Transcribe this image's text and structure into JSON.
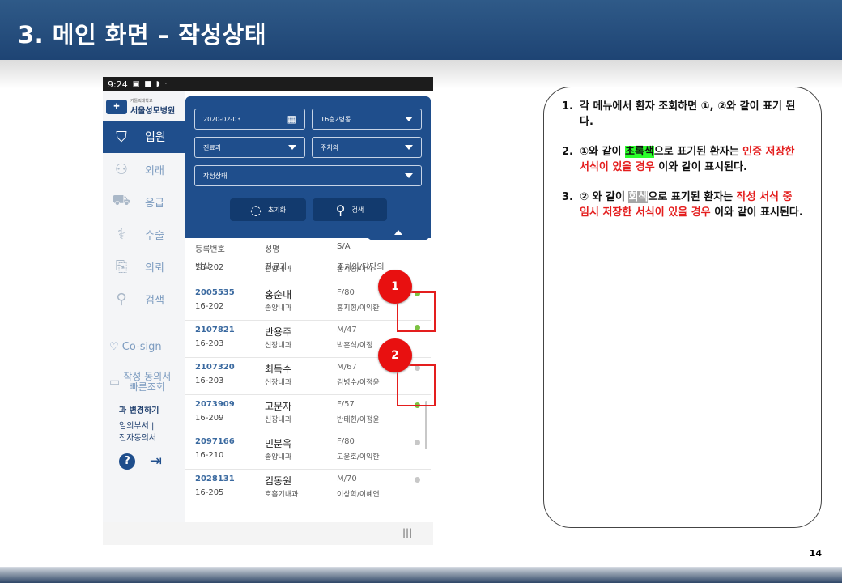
{
  "slide": {
    "title": "3. 메인 화면 – 작성상태",
    "page_number": "14"
  },
  "phone": {
    "status_time": "9:24",
    "hospital_sub": "가톨릭대학교",
    "hospital_name": "서울성모병원",
    "nav": [
      {
        "label": "입원",
        "icon": "inpatient-icon",
        "active": true
      },
      {
        "label": "외래",
        "icon": "outpatient-icon",
        "active": false
      },
      {
        "label": "응급",
        "icon": "ambulance-icon",
        "active": false
      },
      {
        "label": "수술",
        "icon": "surgery-icon",
        "active": false
      },
      {
        "label": "의뢰",
        "icon": "referral-icon",
        "active": false
      },
      {
        "label": "검색",
        "icon": "search-icon",
        "active": false
      }
    ],
    "cosign_label": "Co-sign",
    "consent_label_1": "작성 동의서",
    "consent_label_2": "빠른조회",
    "dept_change": "과 변경하기",
    "temp_link_1": "임의부서 |",
    "temp_link_2": "전자동의서",
    "help_label": "?",
    "filters": {
      "date": "2020-02-03",
      "ward": "16층2병동",
      "dept": "진료과",
      "doctor": "주치의",
      "status": "작성상태",
      "reset_label": "초기화",
      "search_label": "검색"
    },
    "columns": {
      "id": "등록번호",
      "name": "성명",
      "sa": "S/A",
      "room": "병실",
      "dept": "진료과",
      "doctor": "주치의/담당의"
    },
    "rows": [
      {
        "id": "",
        "room": "16-202",
        "name": "",
        "dept": "종양내과",
        "sa": "",
        "doctor": "홍지형/이익",
        "status": "none"
      },
      {
        "id": "2005535",
        "room": "16-202",
        "name": "홍순내",
        "dept": "종양내과",
        "sa": "F/80",
        "doctor": "홍지형/이익환",
        "status": "green"
      },
      {
        "id": "2107821",
        "room": "16-203",
        "name": "반용주",
        "dept": "신장내과",
        "sa": "M/47",
        "doctor": "박훈석/이정",
        "status": "green"
      },
      {
        "id": "2107320",
        "room": "16-203",
        "name": "최득수",
        "dept": "신장내과",
        "sa": "M/67",
        "doctor": "김병수/이정윤",
        "status": "gray"
      },
      {
        "id": "2073909",
        "room": "16-209",
        "name": "고문자",
        "dept": "신장내과",
        "sa": "F/57",
        "doctor": "반태현/이정윤",
        "status": "green"
      },
      {
        "id": "2097166",
        "room": "16-210",
        "name": "민분옥",
        "dept": "종양내과",
        "sa": "F/80",
        "doctor": "고윤호/이익환",
        "status": "gray"
      },
      {
        "id": "2028131",
        "room": "16-205",
        "name": "김동원",
        "dept": "호흡기내과",
        "sa": "M/70",
        "doctor": "이상학/이혜연",
        "status": "gray"
      }
    ]
  },
  "markers": {
    "m1": "1",
    "m2": "2"
  },
  "notes": {
    "n1_num": "1.",
    "n1_text": "각 메뉴에서 환자 조회하면 ①, ②와 같이 표기 된다.",
    "n2_num": "2.",
    "n2_a": "①와 같이 ",
    "n2_hl": "초록색",
    "n2_b": "으로 표기된 환자는 ",
    "n2_red": "인증 저장한 서식이 있을 경우",
    "n2_c": " 이와 같이 표시된다.",
    "n3_num": "3.",
    "n3_a": "② 와 같이 ",
    "n3_hl": "회색",
    "n3_b": "으로 표기된 환자는 ",
    "n3_red": "작성 서식 중 임시 저장한 서식이 있을 경우",
    "n3_c": " 이와 같이 표시된다."
  },
  "colors": {
    "header": "#2f5a88",
    "panel": "#1f4e8c",
    "green_dot": "#7cc242",
    "gray_dot": "#c8c8c8",
    "marker_red": "#e81010"
  }
}
